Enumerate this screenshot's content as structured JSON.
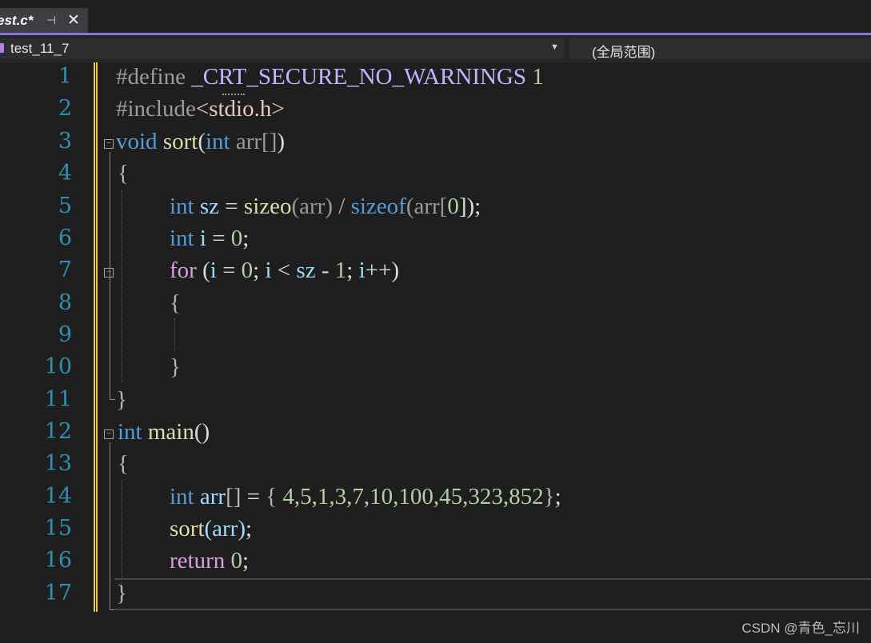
{
  "tab": {
    "title": "est.c*"
  },
  "navbar": {
    "project": "test_11_7",
    "scope": "(全局范围)"
  },
  "lines": [
    {
      "n": "1"
    },
    {
      "n": "2"
    },
    {
      "n": "3"
    },
    {
      "n": "4"
    },
    {
      "n": "5"
    },
    {
      "n": "6"
    },
    {
      "n": "7"
    },
    {
      "n": "8"
    },
    {
      "n": "9"
    },
    {
      "n": "10"
    },
    {
      "n": "11"
    },
    {
      "n": "12"
    },
    {
      "n": "13"
    },
    {
      "n": "14"
    },
    {
      "n": "15"
    },
    {
      "n": "16"
    },
    {
      "n": "17"
    }
  ],
  "code": {
    "l1": {
      "directive": "#define",
      "macro": "_CRT_SECURE_NO_WARNINGS",
      "value": "1"
    },
    "l2": {
      "directive": "#include",
      "header": "<stdio.h>"
    },
    "l3": {
      "ret": "void",
      "name": "sort",
      "open": "(",
      "ptype": "int",
      "param": "arr[]",
      "close": ")"
    },
    "l4": {
      "text": "{"
    },
    "l5": {
      "type": "int",
      "var": "sz",
      "eq": "=",
      "call1": "sizeo",
      "arg1": "(arr)",
      "div": "/",
      "kw": "sizeof",
      "arg2": "(arr[",
      "zero": "0",
      "end": "]);"
    },
    "l6": {
      "type": "int",
      "var": "i",
      "eq": "=",
      "val": "0",
      "end": ";"
    },
    "l7": {
      "kw": "for",
      "open": "(",
      "v1": "i",
      "eq": "=",
      "n1": "0",
      "semi1": ";",
      "v2": "i",
      "lt": "<",
      "v3": "sz",
      "minus": "-",
      "n2": "1",
      "semi2": ";",
      "v4": "i",
      "inc": "++",
      "close": ")"
    },
    "l8": {
      "text": "{"
    },
    "l10": {
      "text": "}"
    },
    "l11": {
      "text": "}"
    },
    "l12": {
      "ret": "int",
      "name": "main",
      "parens": "()"
    },
    "l13": {
      "text": "{"
    },
    "l14": {
      "type": "int",
      "var": "arr",
      "br": "[]",
      "eq": "=",
      "ob": "{",
      "nums": "4,5,1,3,7,10,100,45,323,852",
      "cb": "}",
      "semi": ";"
    },
    "l15": {
      "name": "sort",
      "args": "(arr)",
      "semi": ";"
    },
    "l16": {
      "kw": "return",
      "val": "0",
      "semi": ";"
    },
    "l17": {
      "text": "}"
    }
  },
  "watermark": "CSDN @青色_忘川",
  "colors": {
    "keyword": "#569cd6",
    "control": "#d8a0df",
    "function": "#dcdcaa",
    "number": "#b5cea8",
    "variable": "#9cdcfe",
    "line_number": "#2b91af",
    "change_bar": "#e9c548",
    "accent": "#8a73d6"
  }
}
